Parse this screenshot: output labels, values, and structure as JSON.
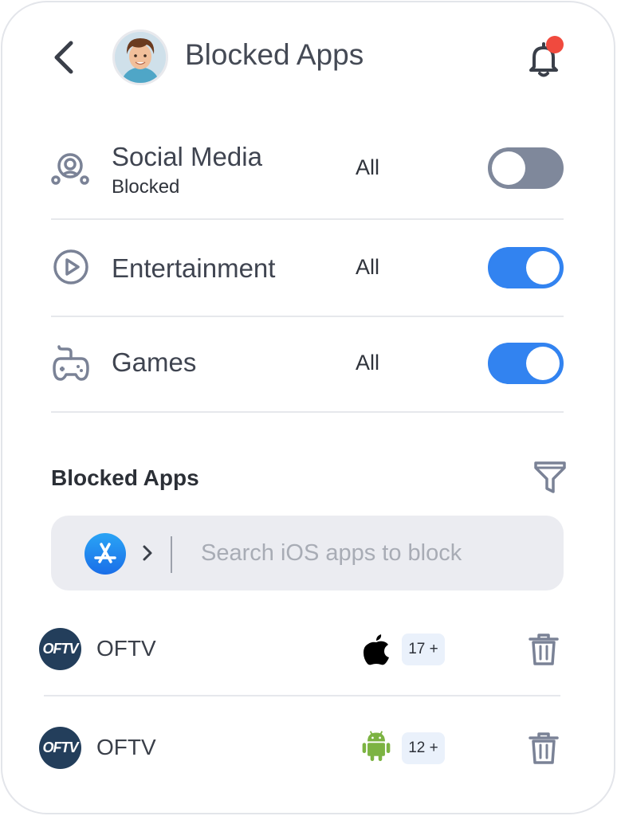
{
  "header": {
    "title": "Blocked Apps",
    "has_notification": true
  },
  "categories": [
    {
      "title": "Social Media",
      "subtitle": "Blocked",
      "scope": "All",
      "enabled": false,
      "icon": "social-network-icon"
    },
    {
      "title": "Entertainment",
      "subtitle": "",
      "scope": "All",
      "enabled": true,
      "icon": "play-circle-icon"
    },
    {
      "title": "Games",
      "subtitle": "",
      "scope": "All",
      "enabled": true,
      "icon": "gamepad-icon"
    }
  ],
  "blocked_section": {
    "title": "Blocked Apps",
    "search_placeholder": "Search iOS apps to block",
    "store_icon": "app-store-icon"
  },
  "apps": [
    {
      "name": "OFTV",
      "logo_text": "OFTV",
      "platform": "apple-icon",
      "age": "17 +"
    },
    {
      "name": "OFTV",
      "logo_text": "OFTV",
      "platform": "android-icon",
      "age": "12 +"
    }
  ],
  "colors": {
    "accent": "#3283f0",
    "toggle_off": "#7f889b",
    "notification_dot": "#f04a3e",
    "android": "#7cb342"
  }
}
